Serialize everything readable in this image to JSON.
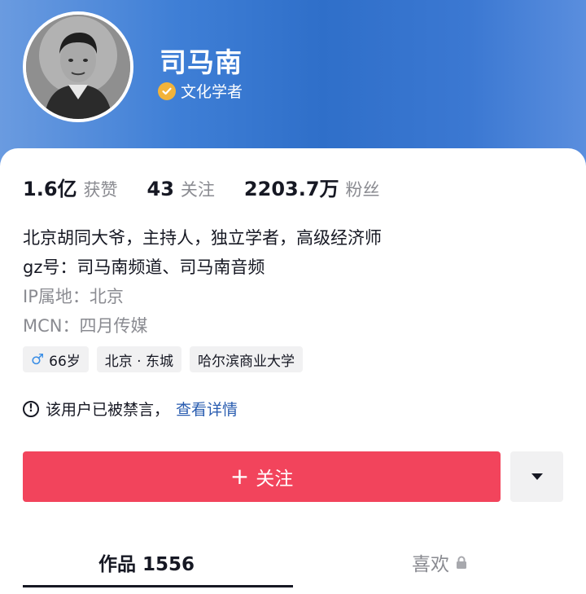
{
  "profile": {
    "name": "司马南",
    "certification": "文化学者",
    "colors": {
      "header": "#3f7fd6",
      "cert_badge": "#f2b33a",
      "follow_button": "#f2445c",
      "link": "#2a5db0"
    }
  },
  "stats": [
    {
      "value": "1.6亿",
      "label": "获赞"
    },
    {
      "value": "43",
      "label": "关注"
    },
    {
      "value": "2203.7万",
      "label": "粉丝"
    }
  ],
  "bio": {
    "line1": "北京胡同大爷，主持人，独立学者，高级经济师",
    "line2": "gz号：司马南频道、司马南音频",
    "ip": "IP属地：北京",
    "mcn": "MCN：四月传媒"
  },
  "tags": {
    "age": "66岁",
    "location": "北京 · 东城",
    "school": "哈尔滨商业大学",
    "gender_icon": "male-icon"
  },
  "notice": {
    "text": "该用户已被禁言，",
    "link": "查看详情",
    "icon": "exclamation-circle-icon"
  },
  "actions": {
    "follow_plus": "+",
    "follow_label": "关注",
    "more_icon": "caret-down-icon"
  },
  "tabs": {
    "works_label": "作品 1556",
    "likes_label": "喜欢",
    "likes_icon": "lock-icon"
  }
}
